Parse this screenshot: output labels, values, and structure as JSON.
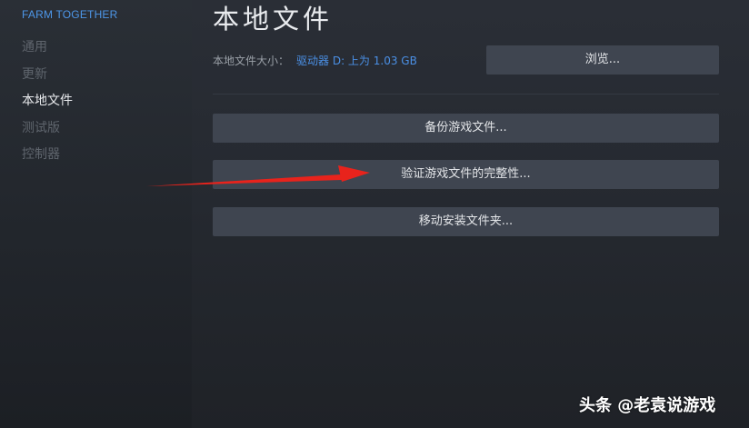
{
  "sidebar": {
    "game_title": "FARM TOGETHER",
    "items": [
      {
        "label": "通用",
        "active": false
      },
      {
        "label": "更新",
        "active": false
      },
      {
        "label": "本地文件",
        "active": true
      },
      {
        "label": "测试版",
        "active": false
      },
      {
        "label": "控制器",
        "active": false
      }
    ]
  },
  "main": {
    "title": "本地文件",
    "size_label": "本地文件大小：",
    "size_value": "驱动器 D: 上为 1.03 GB",
    "browse_label": "浏览...",
    "backup_label": "备份游戏文件...",
    "verify_label": "验证游戏文件的完整性...",
    "move_label": "移动安装文件夹..."
  },
  "watermark": "头条 @老袁说游戏",
  "colors": {
    "accent": "#4a8fe4",
    "button_bg": "#3f4550",
    "annotation_arrow": "#e8231c"
  }
}
